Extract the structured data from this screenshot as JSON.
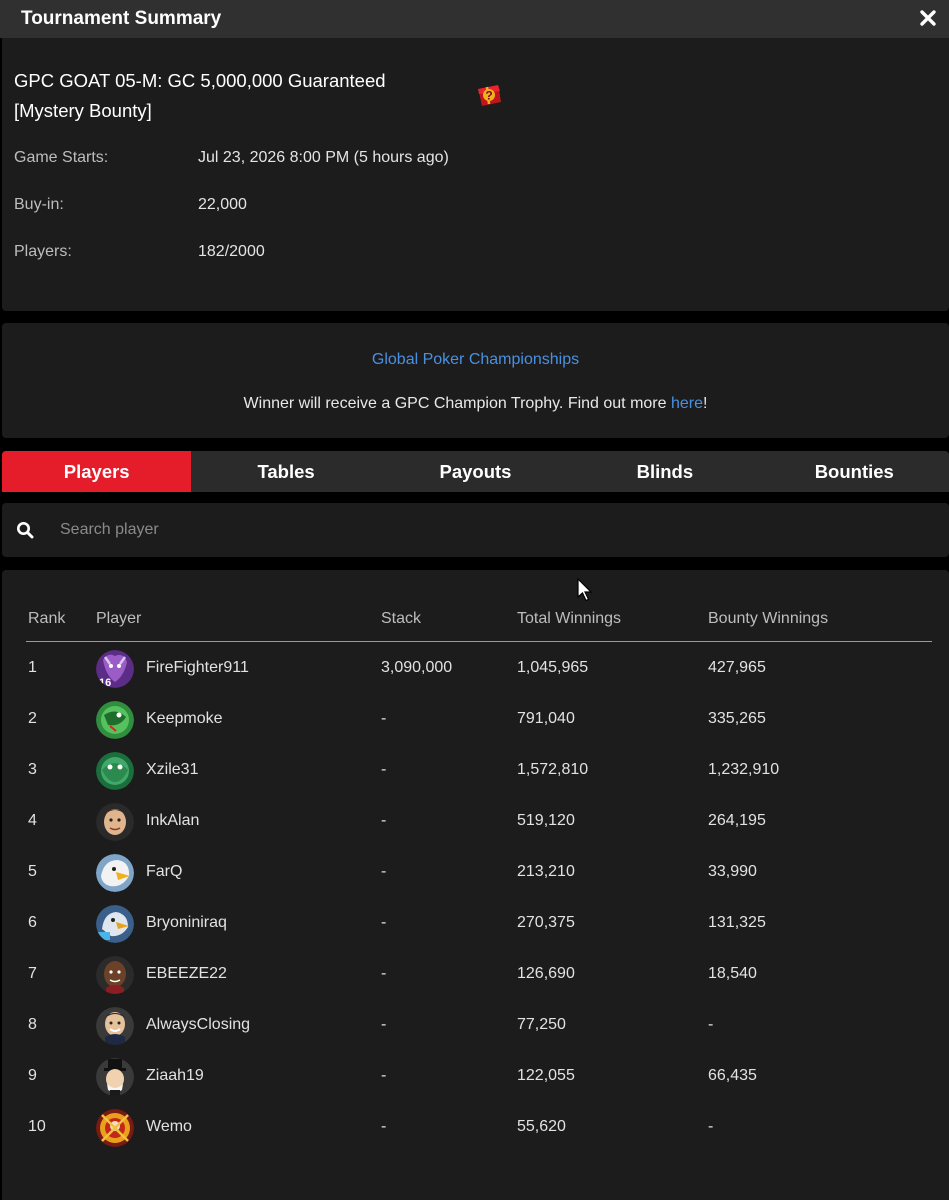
{
  "window": {
    "title": "Tournament Summary"
  },
  "tournament": {
    "name": "GPC GOAT 05-M: GC 5,000,000 Guaranteed [Mystery Bounty]",
    "game_starts_label": "Game Starts:",
    "game_starts_value": "Jul 23, 2026 8:00 PM (5 hours ago)",
    "buyin_label": "Buy-in:",
    "buyin_value": "22,000",
    "players_label": "Players:",
    "players_value": "182/2000"
  },
  "promo": {
    "link_text": "Global Poker Championships",
    "message_prefix": "Winner will receive a GPC Champion Trophy. Find out more ",
    "message_link": "here",
    "message_suffix": "!"
  },
  "tabs": [
    {
      "label": "Players",
      "active": true
    },
    {
      "label": "Tables",
      "active": false
    },
    {
      "label": "Payouts",
      "active": false
    },
    {
      "label": "Blinds",
      "active": false
    },
    {
      "label": "Bounties",
      "active": false
    }
  ],
  "search": {
    "placeholder": "Search player"
  },
  "table": {
    "headers": {
      "rank": "Rank",
      "player": "Player",
      "stack": "Stack",
      "total": "Total Winnings",
      "bounty": "Bounty Winnings"
    },
    "rows": [
      {
        "rank": "1",
        "player": "FireFighter911",
        "stack": "3,090,000",
        "total": "1,045,965",
        "bounty": "427,965"
      },
      {
        "rank": "2",
        "player": "Keepmoke",
        "stack": "-",
        "total": "791,040",
        "bounty": "335,265"
      },
      {
        "rank": "3",
        "player": "Xzile31",
        "stack": "-",
        "total": "1,572,810",
        "bounty": "1,232,910"
      },
      {
        "rank": "4",
        "player": "InkAlan",
        "stack": "-",
        "total": "519,120",
        "bounty": "264,195"
      },
      {
        "rank": "5",
        "player": "FarQ",
        "stack": "-",
        "total": "213,210",
        "bounty": "33,990"
      },
      {
        "rank": "6",
        "player": "Bryoniniraq",
        "stack": "-",
        "total": "270,375",
        "bounty": "131,325"
      },
      {
        "rank": "7",
        "player": "EBEEZE22",
        "stack": "-",
        "total": "126,690",
        "bounty": "18,540"
      },
      {
        "rank": "8",
        "player": "AlwaysClosing",
        "stack": "-",
        "total": "77,250",
        "bounty": "-"
      },
      {
        "rank": "9",
        "player": "Ziaah19",
        "stack": "-",
        "total": "122,055",
        "bounty": "66,435"
      },
      {
        "rank": "10",
        "player": "Wemo",
        "stack": "-",
        "total": "55,620",
        "bounty": "-"
      }
    ]
  },
  "colors": {
    "accent": "#e51c2a",
    "link": "#4a90e2",
    "panel": "#1c1c1c",
    "titlebar": "#303030"
  }
}
